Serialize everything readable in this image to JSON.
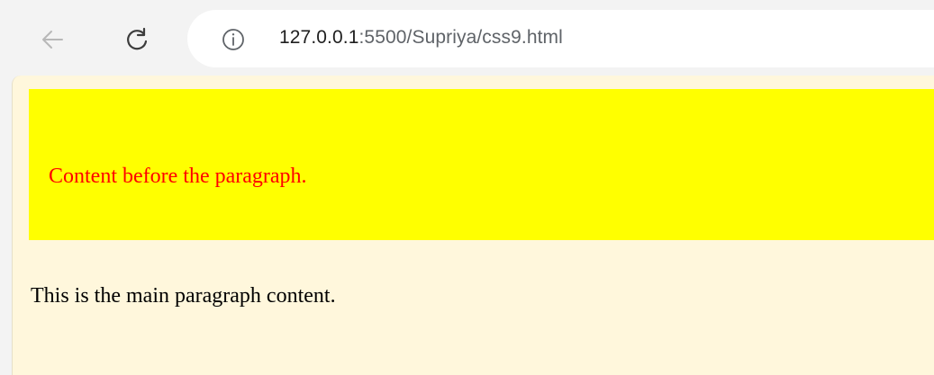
{
  "browser": {
    "address_bar": {
      "url_host": "127.0.0.1",
      "url_path": ":5500/Supriya/css9.html"
    },
    "icons": {
      "back": "back-arrow-icon",
      "reload": "reload-icon",
      "info": "info-icon"
    }
  },
  "page": {
    "before_content": "Content before the paragraph.",
    "paragraph": "This is the main paragraph content.",
    "colors": {
      "page_background": "#fff7dc",
      "before_background": "#ffff00",
      "before_text": "#ff0000",
      "paragraph_text": "#000000"
    }
  }
}
